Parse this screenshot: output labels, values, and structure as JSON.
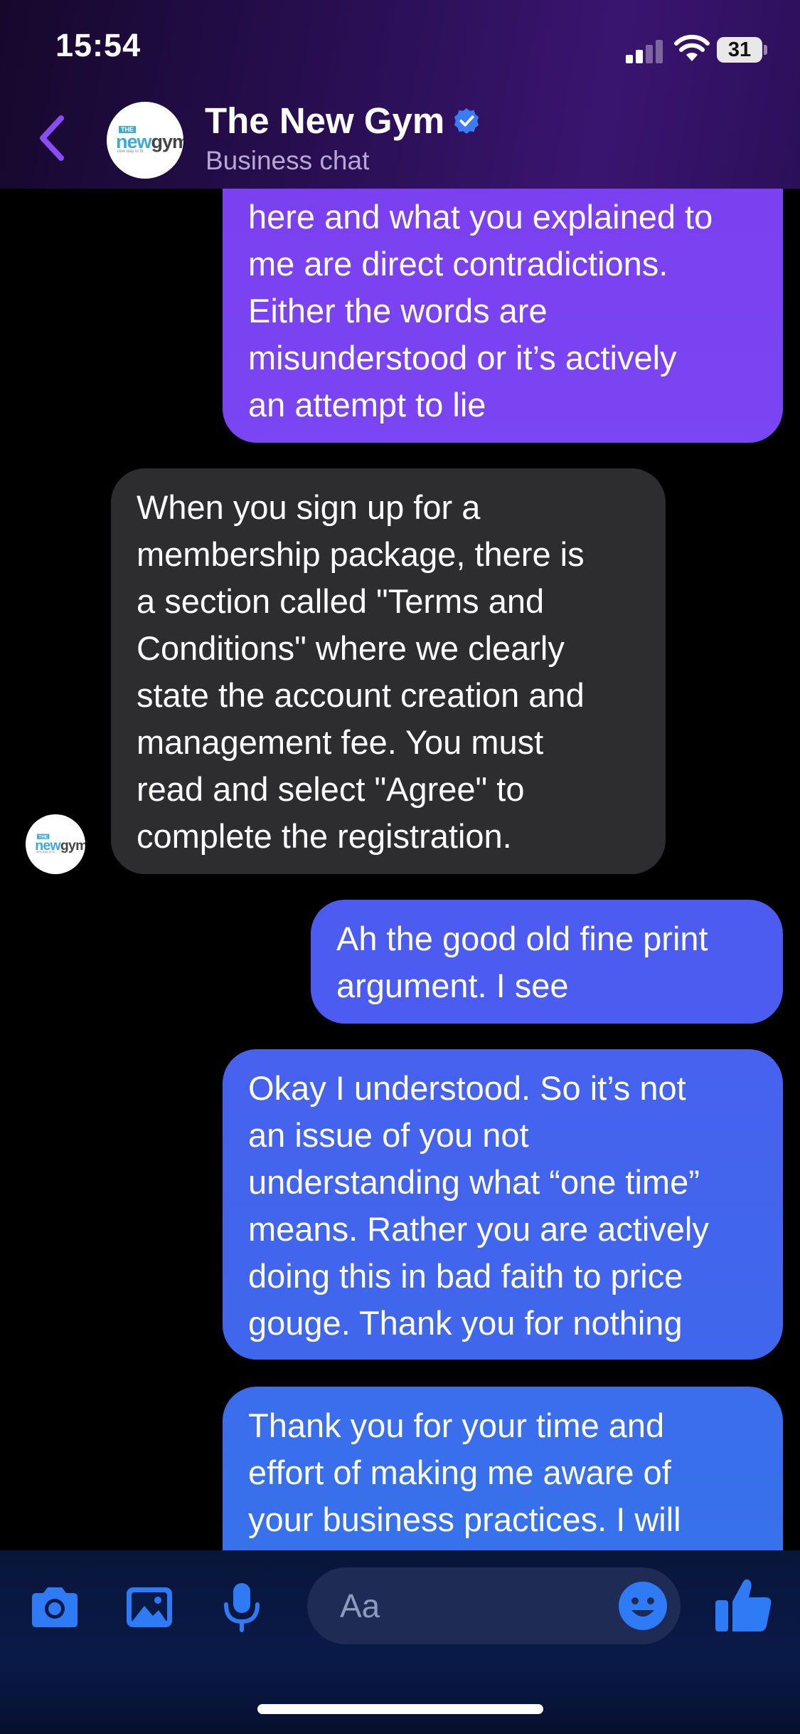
{
  "status_bar": {
    "time": "15:54",
    "battery": "31"
  },
  "header": {
    "contact_name": "The New Gym",
    "subtitle": "Business chat"
  },
  "logo": {
    "the": "THE",
    "new": "new",
    "gym": "gym",
    "tagline": "new way to fit"
  },
  "messages": [
    {
      "direction": "outgoing",
      "text": "here and what you explained to\nme are  direct contradictions.\nEither the words are\nmisunderstood or it’s actively\nan attempt to lie"
    },
    {
      "direction": "incoming",
      "text": "When you sign up for a\nmembership package, there is\na section called \"Terms and\nConditions\" where we clearly\nstate the account creation and\nmanagement fee. You must\nread and select \"Agree\" to\ncomplete the registration."
    },
    {
      "direction": "outgoing",
      "text": "Ah the good old fine print\nargument.  I see"
    },
    {
      "direction": "outgoing",
      "text": "Okay I understood. So it’s not\nan issue of you not\nunderstanding what “one time”\nmeans. Rather you are actively\ndoing this in bad faith to price\ngouge. Thank you for nothing"
    },
    {
      "direction": "outgoing",
      "text": "Thank you for your time and\neffort of making me aware of\nyour business practices. I will"
    }
  ],
  "composer": {
    "placeholder": "Aa"
  },
  "colors": {
    "accent": "#7b40f0",
    "outgoing_blue": "#3f67ec",
    "incoming": "#2d2d2f",
    "composer_icon": "#2f7bf5"
  },
  "icons": [
    "back-chevron-icon",
    "verified-badge-icon",
    "camera-icon",
    "image-icon",
    "microphone-icon",
    "emoji-icon",
    "thumbs-up-icon"
  ]
}
